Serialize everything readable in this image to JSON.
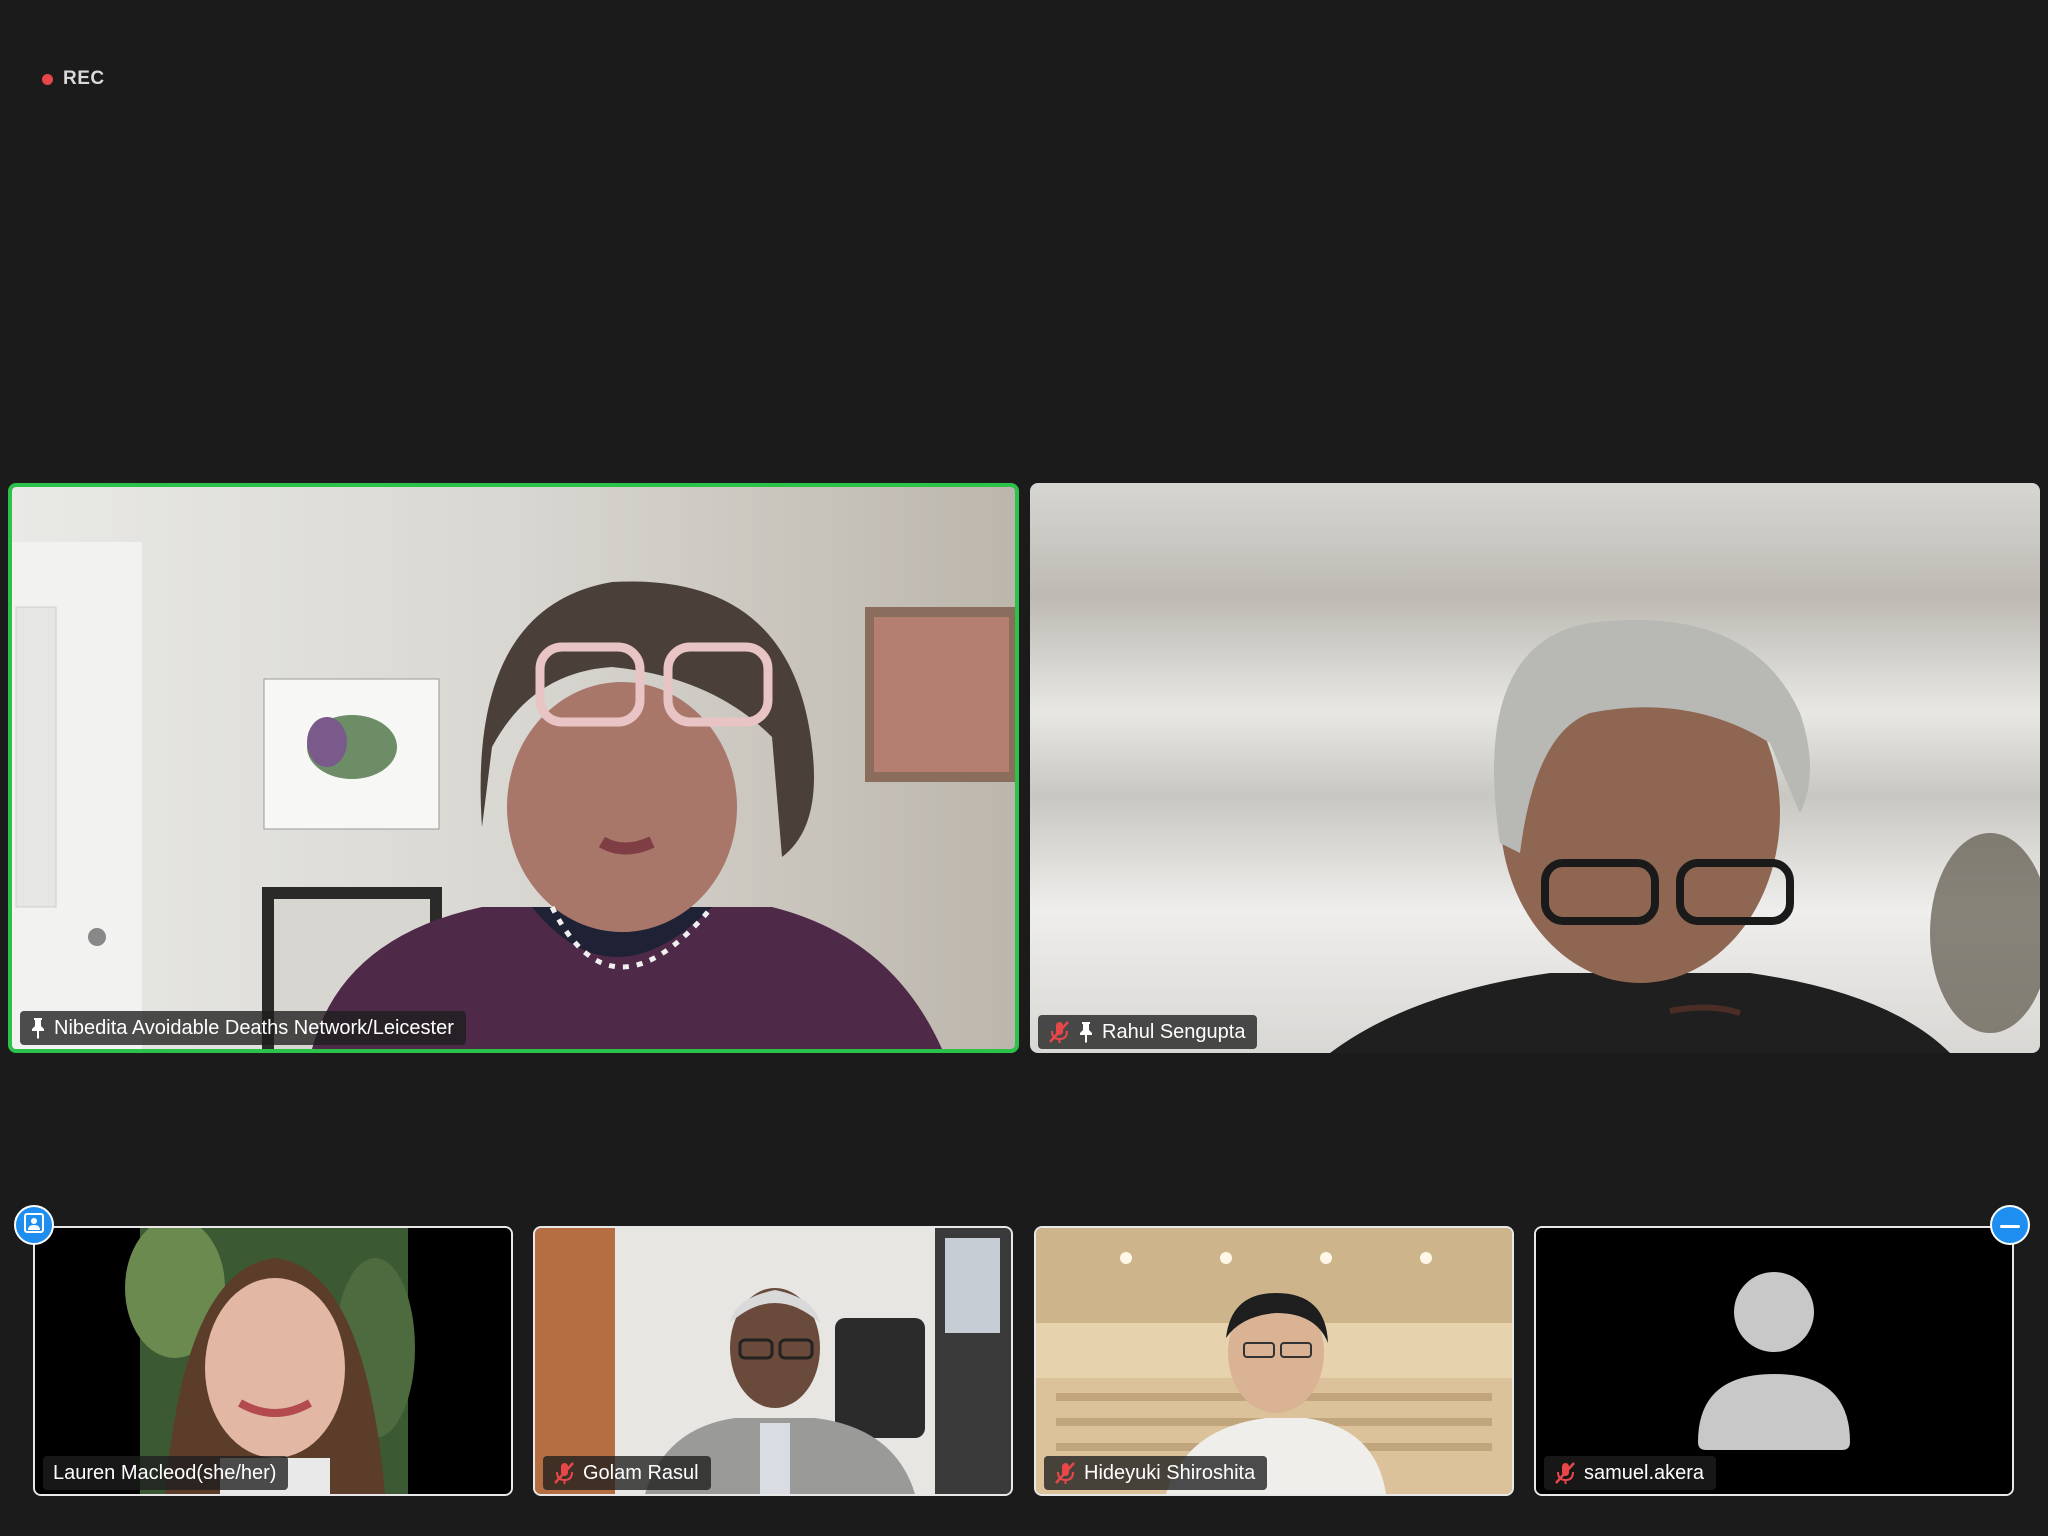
{
  "recording": {
    "label": "REC",
    "color": "#e8474a"
  },
  "speaker": {
    "name": "Nibedita Avoidable Deaths Network/Leicester",
    "pinned": true,
    "active_speaker_border": "#2bc24a"
  },
  "main_second": {
    "name": "Rahul Sengupta",
    "muted": true,
    "pinned": true
  },
  "thumbnails": [
    {
      "name": "Lauren Macleod(she/her)",
      "muted": false
    },
    {
      "name": "Golam Rasul",
      "muted": true
    },
    {
      "name": "Hideyuki Shiroshita",
      "muted": true
    },
    {
      "name": "samuel.akera",
      "muted": true,
      "video_off": true
    }
  ],
  "controls": {
    "left_button_icon": "person-frame-icon",
    "right_button_icon": "minimize-icon",
    "accent": "#1e8ff0"
  }
}
